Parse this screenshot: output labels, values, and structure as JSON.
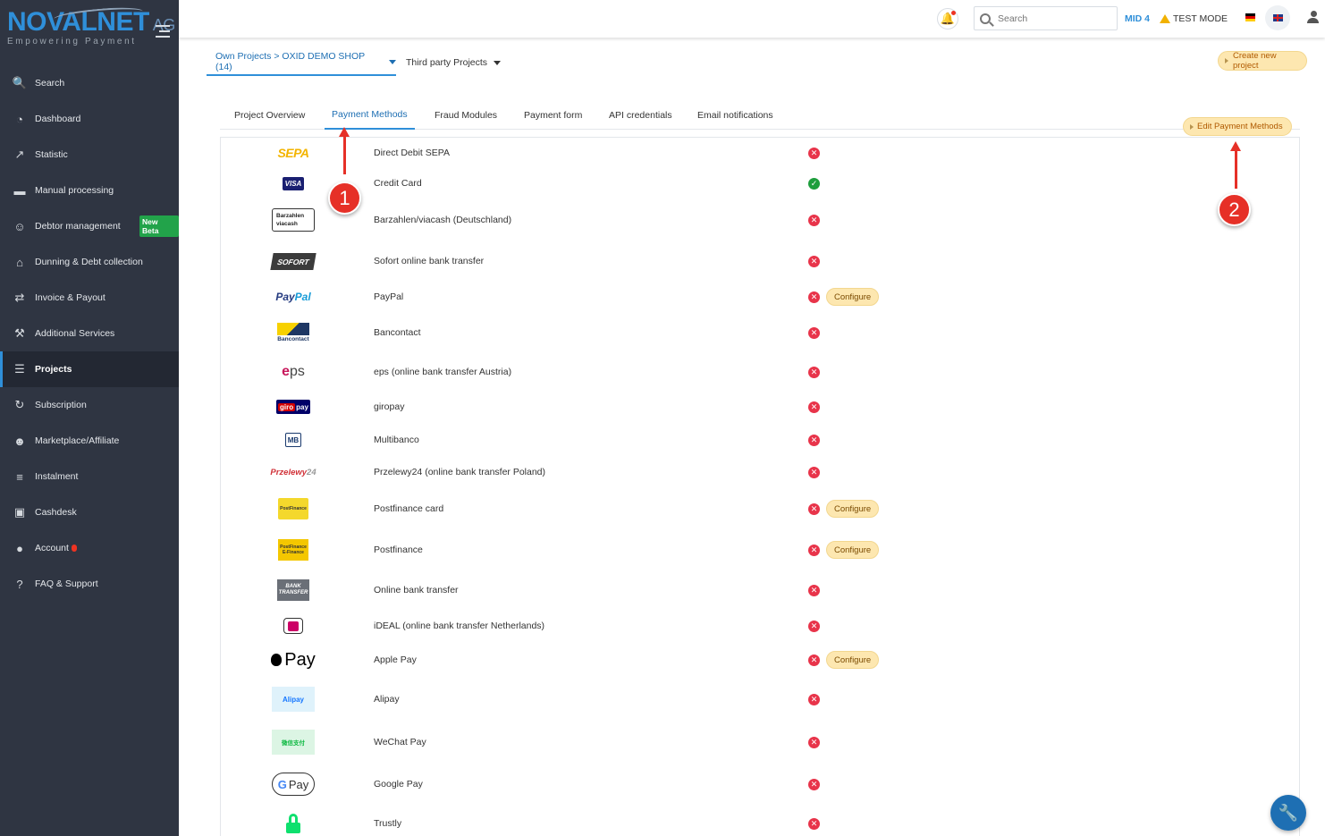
{
  "brand": {
    "name": "NOVALNET",
    "suffix": "AG",
    "tagline": "Empowering Payment"
  },
  "sidebar": {
    "items": [
      {
        "label": "Search",
        "icon": "search-icon"
      },
      {
        "label": "Dashboard",
        "icon": "dashboard-icon"
      },
      {
        "label": "Statistic",
        "icon": "chart-icon"
      },
      {
        "label": "Manual processing",
        "icon": "card-icon"
      },
      {
        "label": "Debtor management",
        "icon": "users-icon",
        "badge": "New Beta"
      },
      {
        "label": "Dunning & Debt collection",
        "icon": "bank-icon"
      },
      {
        "label": "Invoice & Payout",
        "icon": "exchange-icon"
      },
      {
        "label": "Additional Services",
        "icon": "wrench-icon"
      },
      {
        "label": "Projects",
        "icon": "sitemap-icon",
        "active": true
      },
      {
        "label": "Subscription",
        "icon": "refresh-icon"
      },
      {
        "label": "Marketplace/Affiliate",
        "icon": "group-icon"
      },
      {
        "label": "Instalment",
        "icon": "database-icon"
      },
      {
        "label": "Cashdesk",
        "icon": "money-icon"
      },
      {
        "label": "Account",
        "icon": "user-icon",
        "alert": true
      },
      {
        "label": "FAQ & Support",
        "icon": "question-icon"
      }
    ]
  },
  "topbar": {
    "search_placeholder": "Search",
    "mid": "MID 4",
    "test_mode": "TEST MODE"
  },
  "projects": {
    "own": "Own Projects > OXID DEMO SHOP (14)",
    "third_party": "Third party Projects",
    "create_label": "Create new project"
  },
  "tabs": [
    {
      "label": "Project Overview"
    },
    {
      "label": "Payment Methods",
      "active": true
    },
    {
      "label": "Fraud Modules"
    },
    {
      "label": "Payment form"
    },
    {
      "label": "API credentials"
    },
    {
      "label": "Email notifications"
    }
  ],
  "edit_label": "Edit Payment Methods",
  "configure_label": "Configure",
  "payment_methods": [
    {
      "name": "Direct Debit SEPA",
      "enabled": false,
      "configure": false
    },
    {
      "name": "Credit Card",
      "enabled": true,
      "configure": false
    },
    {
      "name": "Barzahlen/viacash (Deutschland)",
      "enabled": false,
      "configure": false
    },
    {
      "name": "Sofort online bank transfer",
      "enabled": false,
      "configure": false
    },
    {
      "name": "PayPal",
      "enabled": false,
      "configure": true
    },
    {
      "name": "Bancontact",
      "enabled": false,
      "configure": false
    },
    {
      "name": "eps (online bank transfer Austria)",
      "enabled": false,
      "configure": false
    },
    {
      "name": "giropay",
      "enabled": false,
      "configure": false
    },
    {
      "name": "Multibanco",
      "enabled": false,
      "configure": false
    },
    {
      "name": "Przelewy24 (online bank transfer Poland)",
      "enabled": false,
      "configure": false
    },
    {
      "name": "Postfinance card",
      "enabled": false,
      "configure": true
    },
    {
      "name": "Postfinance",
      "enabled": false,
      "configure": true
    },
    {
      "name": "Online bank transfer",
      "enabled": false,
      "configure": false
    },
    {
      "name": "iDEAL (online bank transfer Netherlands)",
      "enabled": false,
      "configure": false
    },
    {
      "name": "Apple Pay",
      "enabled": false,
      "configure": true
    },
    {
      "name": "Alipay",
      "enabled": false,
      "configure": false
    },
    {
      "name": "WeChat Pay",
      "enabled": false,
      "configure": false
    },
    {
      "name": "Google Pay",
      "enabled": false,
      "configure": false
    },
    {
      "name": "Trustly",
      "enabled": false,
      "configure": false
    }
  ],
  "logos": {
    "sepa": "SEPA",
    "visa": "VISA",
    "barzahlen": [
      "Barzahlen",
      "viacash"
    ],
    "sofort": "SOFORT",
    "paypal": [
      "Pay",
      "Pal"
    ],
    "bancontact": "Bancontact",
    "eps": [
      "e",
      "ps"
    ],
    "giropay": [
      "giro",
      "pay"
    ],
    "multibanco": "MB",
    "p24": [
      "Przelewy",
      "24"
    ],
    "postfinance_card": "PostFinance",
    "postfinance": [
      "PostFinance",
      "E-Finance"
    ],
    "bank_transfer": [
      "BANK",
      "TRANSFER"
    ],
    "apple_pay": "Pay",
    "alipay": "Alipay",
    "wechat": "微信支付",
    "gpay": [
      "G",
      "Pay"
    ]
  },
  "annotations": [
    "1",
    "2"
  ],
  "status_icons": {
    "enabled": "check-icon",
    "disabled": "cross-icon"
  }
}
